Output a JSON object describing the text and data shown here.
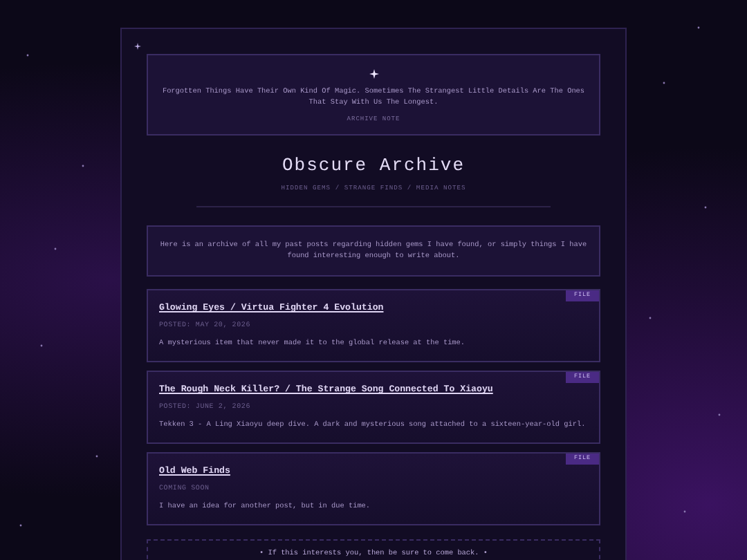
{
  "quote": {
    "text": "Forgotten Things Have Their Own Kind Of Magic. Sometimes The Strangest Little Details Are The Ones That Stay With Us The Longest.",
    "label": "ARCHIVE NOTE"
  },
  "header": {
    "title": "Obscure Archive",
    "subtitle": "HIDDEN GEMS / STRANGE FINDS / MEDIA NOTES"
  },
  "intro": "Here is an archive of all my past posts regarding hidden gems I have found, or simply things I have found interesting enough to write about.",
  "posts": [
    {
      "tag": "FILE",
      "title": "Glowing Eyes / Virtua Fighter 4 Evolution",
      "date": "POSTED: MAY 20, 2026",
      "summary": "A mysterious item that never made it to the global release at the time."
    },
    {
      "tag": "FILE",
      "title": "The Rough Neck Killer? / The Strange Song Connected To Xiaoyu",
      "date": "POSTED: JUNE 2, 2026",
      "summary": "Tekken 3 - A Ling Xiaoyu deep dive. A dark and mysterious song attached to a sixteen-year-old girl."
    },
    {
      "tag": "FILE",
      "title": "Old Web Finds",
      "date": "COMING SOON",
      "summary": "I have an idea for another post, but in due time."
    }
  ],
  "footer": "• If this interests you, then be sure to come back. •"
}
